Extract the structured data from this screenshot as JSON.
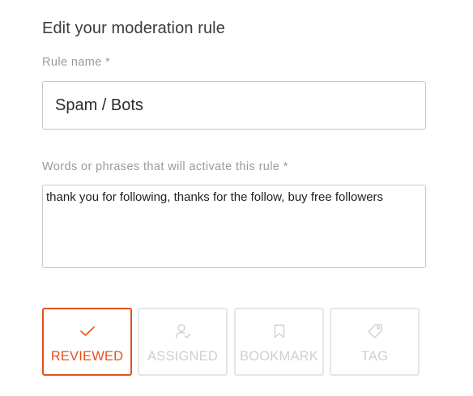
{
  "form": {
    "title": "Edit your moderation rule",
    "rule_name_label": "Rule name *",
    "rule_name_value": "Spam / Bots",
    "phrases_label": "Words or phrases that will activate this rule *",
    "phrases_value": "thank you for following, thanks for the follow, buy free followers"
  },
  "actions": {
    "accent_color": "#e4521e",
    "inactive_color": "#cfcfcf",
    "items": [
      {
        "label": "REVIEWED",
        "icon": "check-icon",
        "selected": true
      },
      {
        "label": "ASSIGNED",
        "icon": "user-check-icon",
        "selected": false
      },
      {
        "label": "BOOKMARK",
        "icon": "bookmark-icon",
        "selected": false
      },
      {
        "label": "TAG",
        "icon": "tag-icon",
        "selected": false
      }
    ]
  }
}
